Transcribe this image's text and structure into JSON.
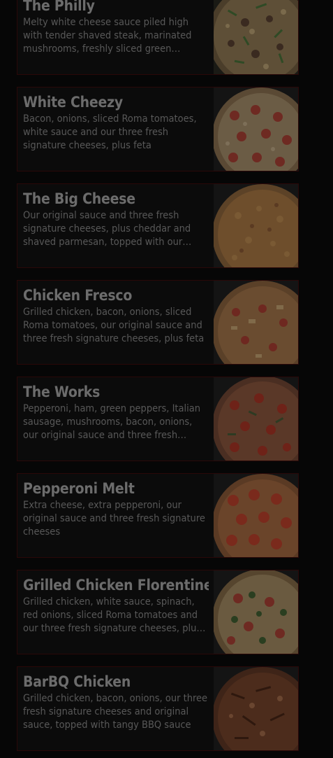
{
  "menu": {
    "items": [
      {
        "name": "The Philly",
        "description": "Melty white cheese sauce piled high with tender shaved steak, marinated mushrooms, freshly sliced green peppers and onions",
        "pizza_image": "philly-pizza"
      },
      {
        "name": "White Cheezy",
        "description": "Bacon, onions, sliced Roma tomatoes, white sauce and our three fresh signature cheeses, plus feta",
        "pizza_image": "white-cheezy-pizza"
      },
      {
        "name": "The Big Cheese",
        "description": "Our original sauce and three fresh signature cheeses, plus cheddar and shaved parmesan, topped with our blend of spices",
        "pizza_image": "big-cheese-pizza"
      },
      {
        "name": "Chicken Fresco",
        "description": "Grilled chicken, bacon, onions, sliced Roma tomatoes, our original sauce and three fresh signature cheeses, plus feta",
        "pizza_image": "chicken-fresco-pizza"
      },
      {
        "name": "The Works",
        "description": "Pepperoni, ham, green peppers, Italian sausage, mushrooms, bacon, onions, our original sauce and three fresh signature cheeses",
        "pizza_image": "works-pizza"
      },
      {
        "name": "Pepperoni Melt",
        "description": "Extra cheese, extra pepperoni, our original sauce and three fresh signature cheeses",
        "pizza_image": "pepperoni-melt-pizza"
      },
      {
        "name": "Grilled Chicken Florentine",
        "description": "Grilled chicken, white sauce, spinach, red onions, sliced Roma tomatoes and our three fresh signature cheeses, plus feta",
        "pizza_image": "chicken-florentine-pizza"
      },
      {
        "name": "BarBQ Chicken",
        "description": "Grilled chicken, bacon, onions, our three fresh signature cheeses and original sauce, topped with tangy BBQ sauce",
        "pizza_image": "bbq-chicken-pizza"
      }
    ]
  },
  "colors": {
    "overlay_bg": "#060606",
    "card_border": "#2a0808",
    "title": "#6c6c6c",
    "desc": "#585858"
  }
}
